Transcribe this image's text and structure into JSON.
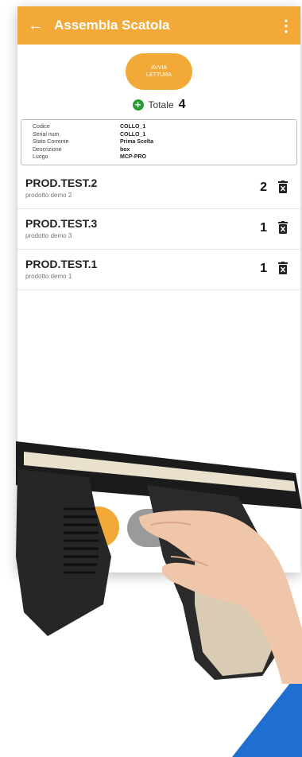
{
  "header": {
    "title": "Assembla Scatola",
    "back_icon": "arrow-left-icon",
    "menu_icon": "more-vert-icon"
  },
  "scan_button": {
    "label_line1": "AVVIA",
    "label_line2": "LETTURA"
  },
  "total": {
    "label": "Totale",
    "value": "4"
  },
  "info": [
    {
      "key": "Codice",
      "value": "COLLO_1"
    },
    {
      "key": "Serial num.",
      "value": "COLLO_1"
    },
    {
      "key": "Stato Corrente",
      "value": "Prima Scelta"
    },
    {
      "key": "Descrizione",
      "value": "box"
    },
    {
      "key": "Luogo",
      "value": "MCP-PRO"
    }
  ],
  "items": [
    {
      "name": "PROD.TEST.2",
      "desc": "prodotto demo 2",
      "qty": "2"
    },
    {
      "name": "PROD.TEST.3",
      "desc": "prodotto demo 3",
      "qty": "1"
    },
    {
      "name": "PROD.TEST.1",
      "desc": "prodotto demo 1",
      "qty": "1"
    }
  ],
  "colors": {
    "accent": "#f2a938",
    "plus": "#2b9a3a",
    "corner": "#1f6fd1"
  }
}
